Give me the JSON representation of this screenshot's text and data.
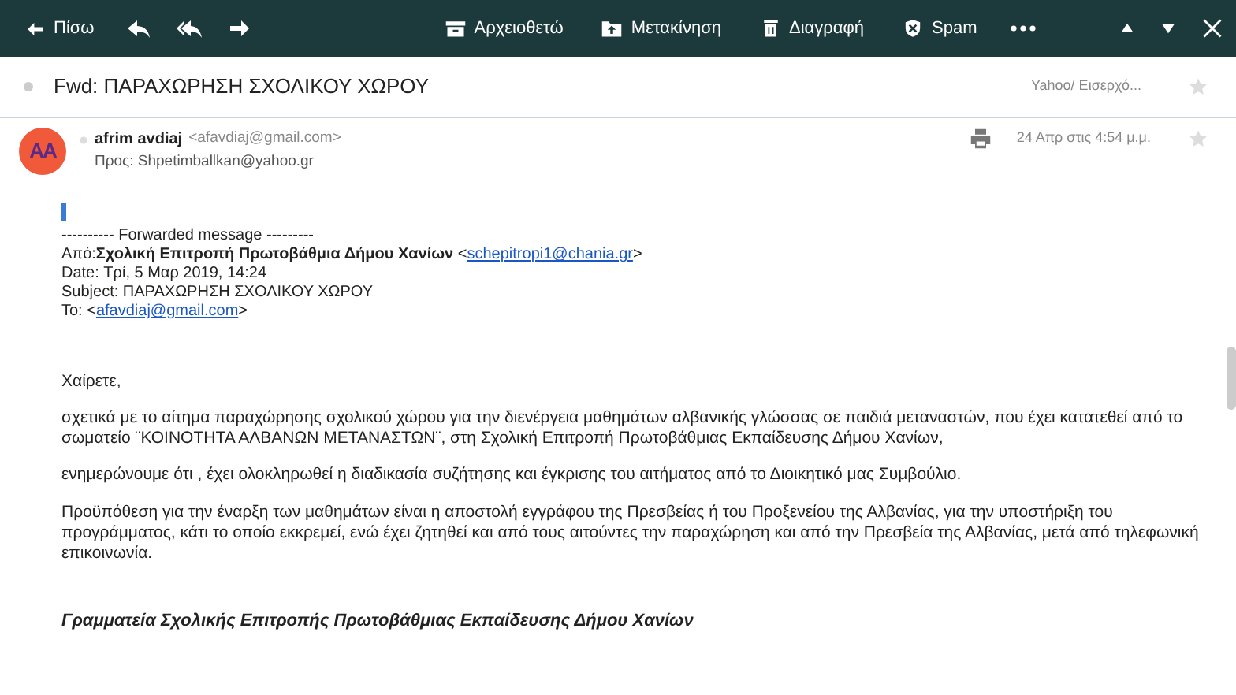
{
  "toolbar": {
    "back": "Πίσω",
    "actions": [
      {
        "kind": "archive",
        "label": "Αρχειοθετώ"
      },
      {
        "kind": "move",
        "label": "Μετακίνηση"
      },
      {
        "kind": "delete",
        "label": "Διαγραφή"
      },
      {
        "kind": "spam",
        "label": "Spam"
      }
    ]
  },
  "subject_bar": {
    "subject": "Fwd: ΠΑΡΑΧΩΡΗΣΗ ΣΧΟΛΙΚΟΥ ΧΩΡΟΥ",
    "folder": "Yahoo/ Εισερχό...",
    "starred": false
  },
  "message": {
    "avatar_text": "AA",
    "sender_name": "afrim avdiaj",
    "sender_email": "<afavdiaj@gmail.com>",
    "to": "Προς: Shpetimballkan@yahoo.gr",
    "date": "24 Απρ στις 4:54 μ.μ.",
    "starred": false,
    "forward_header": {
      "title": "---------- Forwarded message ---------",
      "from": {
        "label": "Από:",
        "name": "Σχολική Επιτροπή Πρωτοβάθμια Δήμου Χανίων",
        "before_link": "<",
        "link": "schepitropi1@chania.gr",
        "after_link": ">"
      },
      "date": "Date: Τρί, 5 Μαρ 2019, 14:24",
      "subject": "Subject: ΠΑΡΑΧΩΡΗΣΗ ΣΧΟΛΙΚΟΥ ΧΩΡΟΥ",
      "to": {
        "label": "To:",
        "before_link": "<",
        "link": "afavdiaj@gmail.com",
        "after_link": ">"
      }
    },
    "paragraphs": [
      "Χαίρετε,",
      "σχετικά με το αίτημα παραχώρησης σχολικού χώρου για την διενέργεια μαθημάτων αλβανικής γλώσσας σε παιδιά μεταναστών, που έχει κατατεθεί από το σωματείο ¨ΚΟΙΝΟΤΗΤΑ ΑΛΒΑΝΩΝ ΜΕΤΑΝΑΣΤΩΝ¨, στη Σχολική Επιτροπή Πρωτοβάθμιας Εκπαίδευσης Δήμου Χανίων,",
      "ενημερώνουμε ότι , έχει ολοκληρωθεί η διαδικασία συζήτησης και έγκρισης του αιτήματος από το Διοικητικό μας Συμβούλιο.",
      "Προϋπόθεση για την έναρξη των μαθημάτων είναι η αποστολή εγγράφου της Πρεσβείας ή του Προξενείου της Αλβανίας, για την υποστήριξη του προγράμματος, κάτι το οποίο εκκρεμεί, ενώ έχει ζητηθεί και από τους αιτούντες την παραχώρηση και από την Πρεσβεία της Αλβανίας, μετά από τηλεφωνική επικοινωνία."
    ],
    "signature": "Γραμματεία Σχολικής Επιτροπής Πρωτοβάθμιας Εκπαίδευσης Δήμου Χανίων"
  }
}
